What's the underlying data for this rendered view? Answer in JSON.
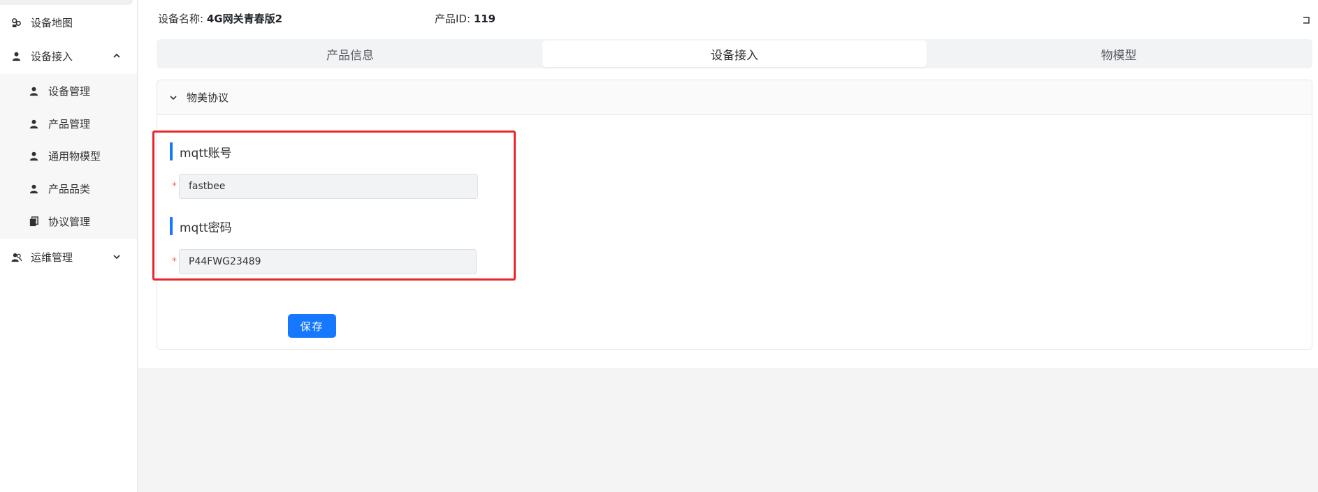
{
  "sidebar": {
    "items": [
      {
        "label": "设备地图",
        "icon": "map-pins-icon"
      },
      {
        "label": "设备接入",
        "icon": "user-icon",
        "expanded": true
      },
      {
        "label": "设备管理",
        "icon": "user-icon"
      },
      {
        "label": "产品管理",
        "icon": "user-icon"
      },
      {
        "label": "通用物模型",
        "icon": "user-icon"
      },
      {
        "label": "产品品类",
        "icon": "user-icon"
      },
      {
        "label": "协议管理",
        "icon": "document-stack-icon"
      },
      {
        "label": "运维管理",
        "icon": "users-icon",
        "expanded": false
      }
    ]
  },
  "header": {
    "device_name_label": "设备名称:",
    "device_name_value": "4G网关青春版2",
    "product_id_label": "产品ID:",
    "product_id_value": "119"
  },
  "tabs": [
    {
      "label": "产品信息",
      "active": false
    },
    {
      "label": "设备接入",
      "active": true
    },
    {
      "label": "物模型",
      "active": false
    }
  ],
  "panel": {
    "title": "物美协议"
  },
  "form": {
    "account_title": "mqtt账号",
    "account_value": "fastbee",
    "password_title": "mqtt密码",
    "password_value": "P44FWG23489",
    "required_mark": "*",
    "save_label": "保存"
  },
  "colors": {
    "accent": "#1677ff",
    "highlight": "#e8262b",
    "required": "#f56c6c"
  }
}
